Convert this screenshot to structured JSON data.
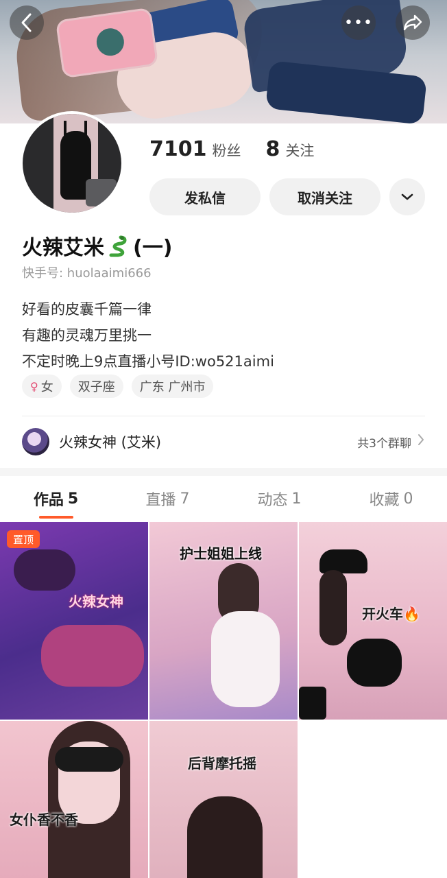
{
  "header": {
    "more_label": "•••"
  },
  "stats": {
    "fans_count": "7101",
    "fans_label": "粉丝",
    "following_count": "8",
    "following_label": "关注"
  },
  "actions": {
    "message_label": "发私信",
    "unfollow_label": "取消关注"
  },
  "profile": {
    "name": "火辣艾米",
    "name_suffix": "(一)",
    "account_id": "快手号: huolaaimi666",
    "bio": [
      "好看的皮囊千篇一律",
      "有趣的灵魂万里挑一",
      "不定时晚上9点直播小号ID:wo521aimi"
    ],
    "tags": {
      "gender": "女",
      "zodiac": "双子座",
      "location": "广东 广州市"
    }
  },
  "group_chat": {
    "name": "火辣女神 (艾米)",
    "count_label": "共3个群聊"
  },
  "tabs": [
    {
      "label": "作品",
      "count": "5"
    },
    {
      "label": "直播",
      "count": "7"
    },
    {
      "label": "动态",
      "count": "1"
    },
    {
      "label": "收藏",
      "count": "0"
    }
  ],
  "works": [
    {
      "caption": "火辣女神",
      "pinned_label": "置顶"
    },
    {
      "caption": "护士姐姐上线"
    },
    {
      "caption": "开火车"
    },
    {
      "caption": "女仆香不香"
    },
    {
      "caption": "后背摩托摇"
    }
  ],
  "colors": {
    "accent": "#ff5a2a",
    "text_primary": "#222222",
    "text_secondary": "#999999",
    "pill_bg": "#f1f1f1"
  }
}
